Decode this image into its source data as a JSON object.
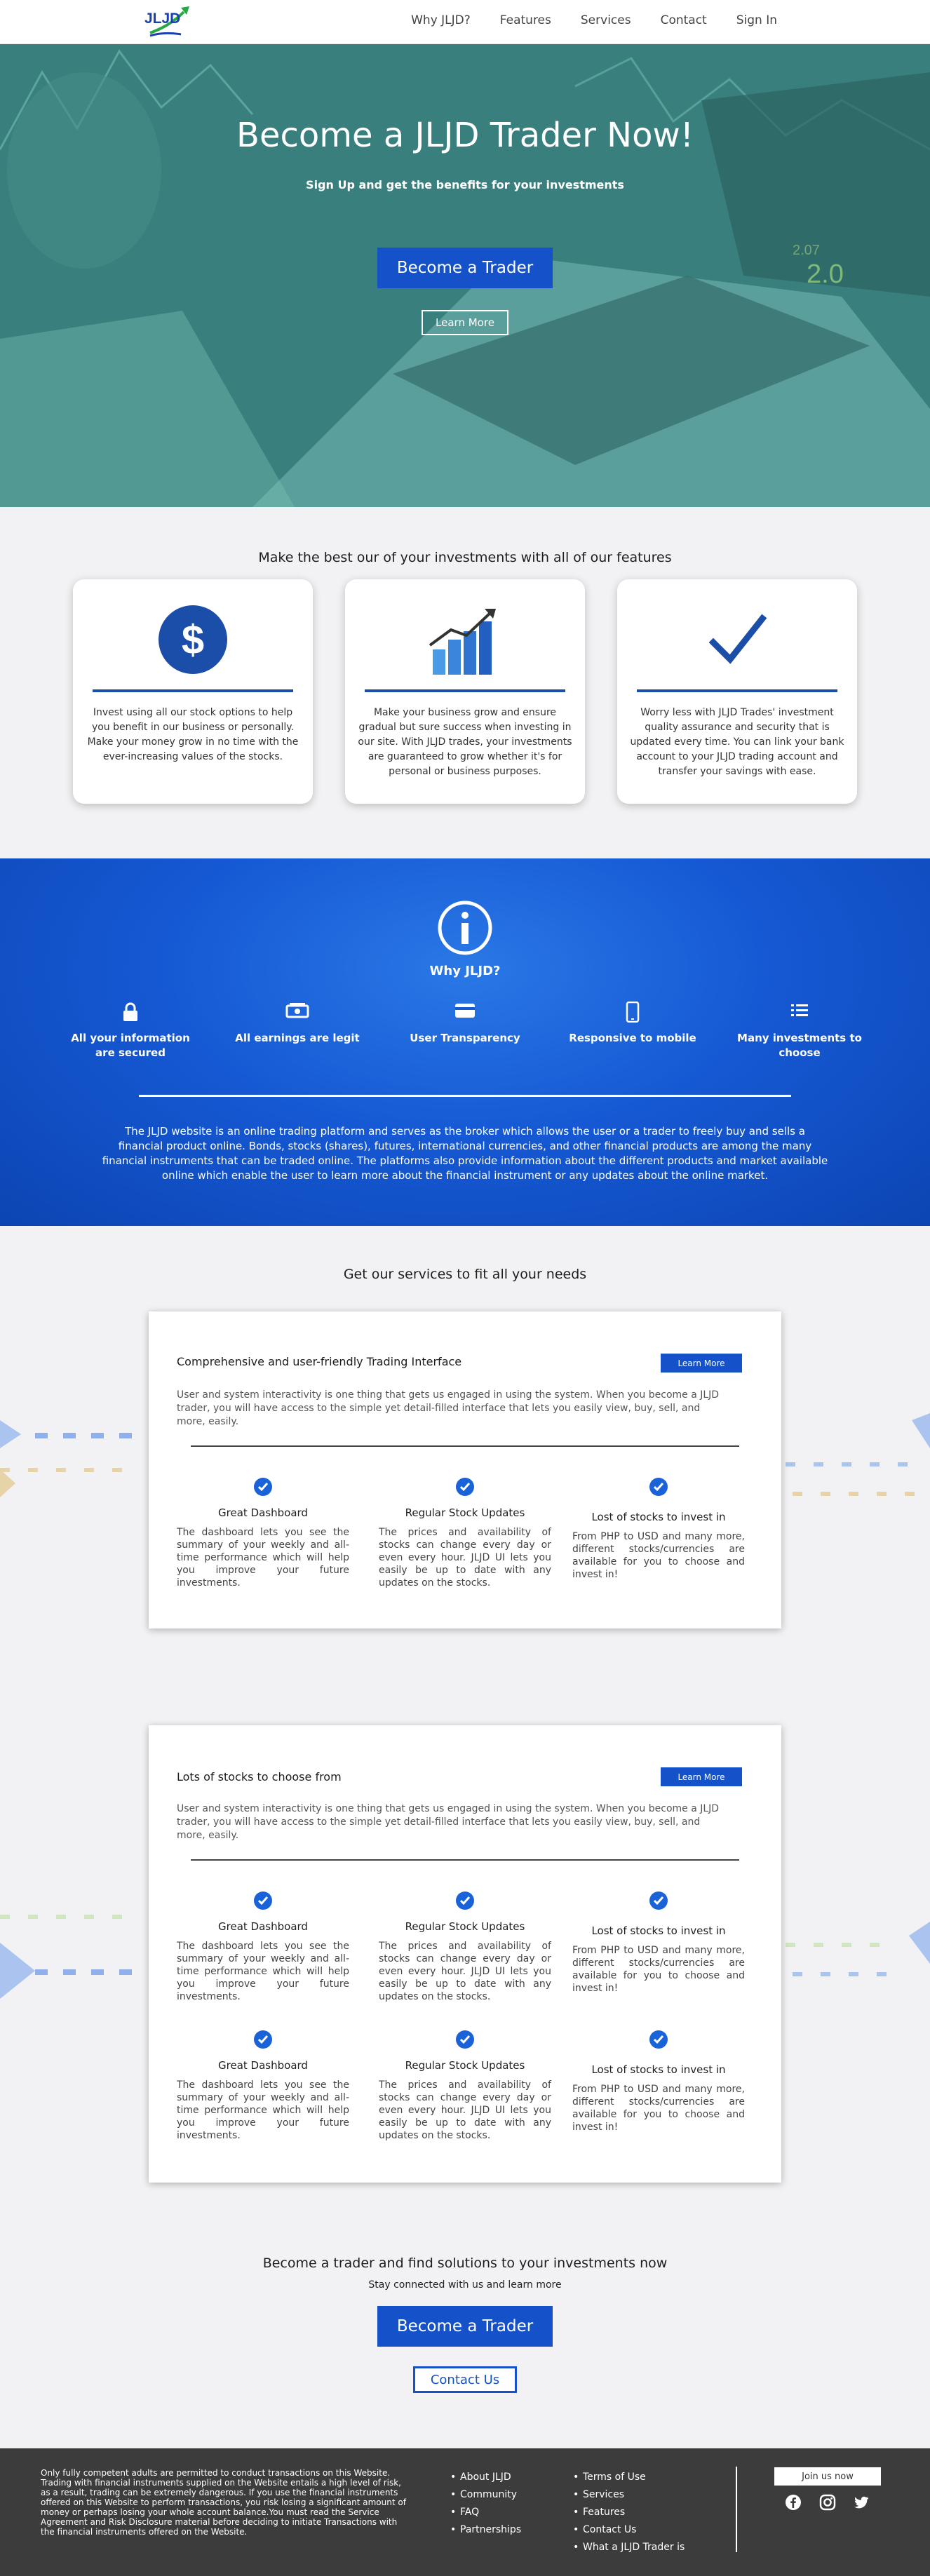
{
  "nav": {
    "logo_text": "JLJD",
    "links": [
      "Why JLJD?",
      "Features",
      "Services",
      "Contact",
      "Sign In"
    ]
  },
  "hero": {
    "title": "Become a JLJD Trader Now!",
    "subtitle": "Sign Up and get the benefits for your investments",
    "primary_button": "Become a Trader",
    "secondary_button": "Learn More"
  },
  "features": {
    "title": "Make the best our of your investments with all of our features",
    "cards": [
      {
        "icon": "dollar-icon",
        "text": "Invest using all our stock options to help you benefit in our business or personally. Make your money grow in no time with the ever-increasing values of the stocks."
      },
      {
        "icon": "growth-chart-icon",
        "text": "Make your business grow and ensure gradual but sure success when investing in our site. With JLJD trades, your investments are guaranteed to grow whether it's for personal or business purposes."
      },
      {
        "icon": "checkmark-icon",
        "text": "Worry less with JLJD Trades' investment quality assurance and security that is updated every time. You can link your bank account to your JLJD trading account and transfer your savings with ease."
      }
    ]
  },
  "why": {
    "icon": "info-icon",
    "title": "Why JLJD?",
    "items": [
      {
        "icon": "lock-icon",
        "label": "All your information are secured"
      },
      {
        "icon": "money-icon",
        "label": "All earnings are legit"
      },
      {
        "icon": "card-icon",
        "label": "User Transparency"
      },
      {
        "icon": "mobile-icon",
        "label": "Responsive to mobile"
      },
      {
        "icon": "list-icon",
        "label": "Many investments to choose"
      }
    ],
    "text": "The JLJD website is an online trading platform and serves as the broker which allows the user or a trader to freely buy and sells a financial product online. Bonds, stocks (shares), futures, international currencies, and other financial products are among the many financial instruments that can be traded online. The platforms also provide information about the different products and market available online which enable the user to learn more about the financial instrument or any updates about the online market."
  },
  "services": {
    "title": "Get our services to fit all your needs",
    "card1": {
      "heading": "Comprehensive and user-friendly Trading Interface",
      "button": "Learn More",
      "paragraph": "User and system interactivity is one thing that gets us engaged in using the system. When you become a JLJD trader, you will have access to the simple yet detail-filled interface that lets you easily view, buy, sell, and more, easily.",
      "cols": [
        {
          "title": "Great Dashboard",
          "text": "The dashboard lets you see the summary of your weekly and all-time performance which will help you improve your future investments."
        },
        {
          "title": "Regular Stock Updates",
          "text": "The prices and availability of stocks can change every day or even every hour. JLJD UI lets you easily be up to date with any updates on the stocks."
        },
        {
          "title": "Lost of stocks to invest in",
          "text": "From PHP to USD and many more, different stocks/currencies are available for you to choose and invest in!"
        }
      ]
    },
    "card2": {
      "heading": "Lots of stocks to choose from",
      "button": "Learn More",
      "paragraph": "User and system interactivity is one thing that gets us engaged in using the system. When you become a JLJD trader, you will have access to the simple yet detail-filled interface that lets you easily view, buy, sell, and more, easily.",
      "rows": [
        [
          {
            "title": "Great Dashboard",
            "text": "The dashboard lets you see the summary of your weekly and all-time performance which will help you improve your future investments."
          },
          {
            "title": "Regular Stock Updates",
            "text": "The prices and availability of stocks can change every day or even every hour. JLJD UI lets you easily be up to date with any updates on the stocks."
          },
          {
            "title": "Lost of stocks to invest in",
            "text": "From PHP to USD and many more, different stocks/currencies are available for you to choose and invest in!"
          }
        ],
        [
          {
            "title": "Great Dashboard",
            "text": "The dashboard lets you see the summary of your weekly and all-time performance which will help you improve your future investments."
          },
          {
            "title": "Regular Stock Updates",
            "text": "The prices and availability of stocks can change every day or even every hour. JLJD UI lets you easily be up to date with any updates on the stocks."
          },
          {
            "title": "Lost of stocks to invest in",
            "text": "From PHP to USD and many more, different stocks/currencies are available for you to choose and invest in!"
          }
        ]
      ]
    }
  },
  "cta": {
    "title": "Become a trader and find solutions to your investments now",
    "subtitle": "Stay connected with us and learn more",
    "primary_button": "Become a Trader",
    "contact_button": "Contact Us"
  },
  "footer": {
    "disclaimer": "Only fully competent adults are permitted to conduct transactions on this Website. Trading with financial instruments supplied on the Website entails a high level of risk, as a result, trading can be extremely dangerous. If you use the financial instruments offered on this Website to perform transactions, you risk losing a significant amount of money or perhaps losing your whole account balance.You must read the Service Agreement and Risk Disclosure material before deciding to initiate Transactions with the financial instruments offered on the Website.",
    "links1": [
      "About JLJD",
      "Community",
      "FAQ",
      "Partnerships"
    ],
    "links2": [
      "Terms of Use",
      "Services",
      "Features",
      "Contact Us",
      "What a JLJD Trader is"
    ],
    "join_button": "Join us now",
    "social": [
      "facebook-icon",
      "instagram-icon",
      "twitter-icon"
    ]
  },
  "colors": {
    "brand_blue": "#1552c9",
    "why_blue": "#1659d4",
    "footer": "#3c3c3c",
    "hero_teal": "#4fbfae"
  }
}
